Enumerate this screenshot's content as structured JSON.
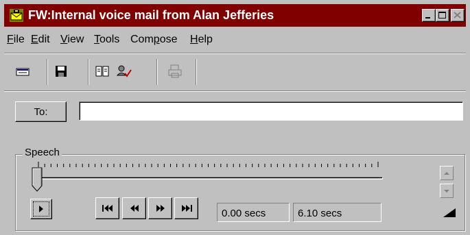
{
  "window": {
    "title": "FW:Internal voice mail from Alan Jefferies",
    "icon": "mail-envelope-icon"
  },
  "menu": [
    {
      "label": "File",
      "key": "F",
      "rest": "ile"
    },
    {
      "label": "Edit",
      "key": "E",
      "rest": "dit"
    },
    {
      "label": "View",
      "key": "V",
      "rest": "iew"
    },
    {
      "label": "Tools",
      "key": "T",
      "rest": "ools"
    },
    {
      "label": "Compose",
      "pre": "Com",
      "key": "p",
      "rest": "ose"
    },
    {
      "label": "Help",
      "key": "H",
      "rest": "elp"
    }
  ],
  "toolbar": {
    "buttons": [
      "new-message-icon",
      "save-icon",
      "address-book-icon",
      "check-names-icon",
      "print-icon"
    ]
  },
  "recipient": {
    "to_label": "To:",
    "to_value": ""
  },
  "speech": {
    "group_label": "Speech",
    "position_fraction": 0.0,
    "elapsed": "0.00 secs",
    "total": "6.10 secs"
  },
  "colors": {
    "titlebar": "#800000",
    "face": "#c0c0c0"
  }
}
